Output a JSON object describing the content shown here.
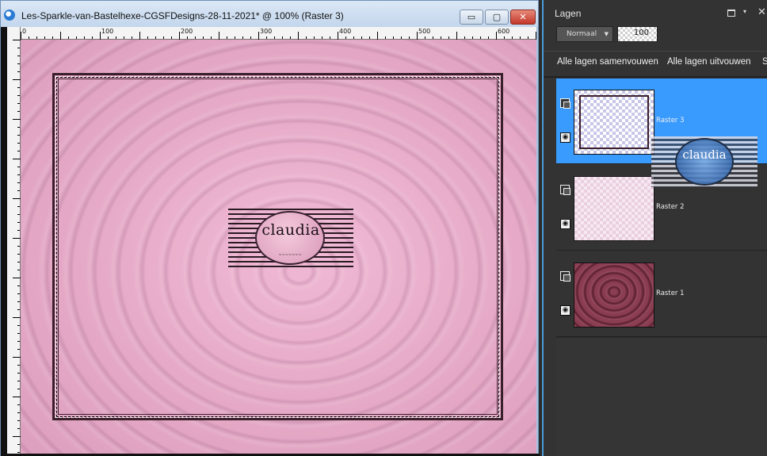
{
  "document": {
    "title": "Les-Sparkle-van-Bastelhexe-CGSFDesigns-28-11-2021* @ 100% (Raster 3)",
    "minimize_glyph": "▭",
    "maximize_glyph": "▢",
    "close_glyph": "✕",
    "ruler_ticks": [
      "0",
      "100",
      "200",
      "300",
      "400",
      "500",
      "600"
    ],
    "logo_text": "claudia",
    "logo_subtext": "~~~~~~~"
  },
  "palette": {
    "title": "Lagen",
    "dropdown_glyph": "▾",
    "close_glyph": "✕",
    "blend_mode": "Normaal",
    "blend_arrow": "▼",
    "opacity": "100",
    "actions": {
      "expand_all": "Alle lagen samenvouwen",
      "collapse_all": "Alle lagen uitvouwen",
      "overflow": "S"
    },
    "layers": [
      {
        "name": "Raster 3",
        "selected": true,
        "eye": "◉"
      },
      {
        "name": "Raster 2",
        "selected": false,
        "eye": "◉"
      },
      {
        "name": "Raster 1",
        "selected": false,
        "eye": "◉"
      }
    ],
    "drag_ghost_text": "claudia"
  },
  "colors": {
    "selection_blue": "#3a9bff",
    "canvas_pink": "#e7acc9",
    "frame_dark": "#3a1f2b",
    "palette_bg": "#333333"
  }
}
